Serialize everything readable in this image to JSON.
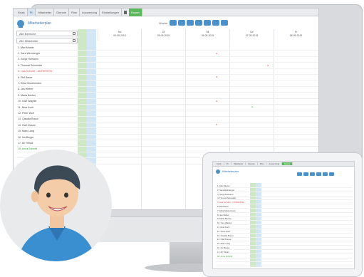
{
  "monitor": {
    "tabs": [
      "Kiosk",
      "Pl.",
      "Mitarbeiter",
      "Dienste",
      "Plan",
      "Auswertung",
      "Einstellungen",
      "",
      "Export"
    ],
    "app_title": "Mitarbeiterplan",
    "week_label": "Woche",
    "filters": [
      "Alle Bereiche",
      "Alle Mitarbeiter"
    ],
    "days": [
      {
        "name": "Mo",
        "date": "04.05.2015"
      },
      {
        "name": "Di",
        "date": "05.05.2015"
      },
      {
        "name": "Mi",
        "date": "06.05.2015"
      },
      {
        "name": "Do",
        "date": "07.05.2015"
      },
      {
        "name": "Fr",
        "date": "08.05.2015"
      }
    ],
    "rows": [
      {
        "name": "1. Max Muster",
        "style": ""
      },
      {
        "name": "2. Sara Weinberger",
        "style": ""
      },
      {
        "name": "3. Sonja Hofmann",
        "style": ""
      },
      {
        "name": "4. Thomas Schneider",
        "style": ""
      },
      {
        "name": "5. Lisa Schulze - UNTERSTEL",
        "style": "red"
      },
      {
        "name": "6. Phil Bauer",
        "style": ""
      },
      {
        "name": "7. Erika Mustermann",
        "style": ""
      },
      {
        "name": "8. Jan Weber",
        "style": ""
      },
      {
        "name": "9. Maria Becker",
        "style": ""
      },
      {
        "name": "10. Uwe Wagner",
        "style": ""
      },
      {
        "name": "11. Nina Koch",
        "style": ""
      },
      {
        "name": "12. Peter Wolf",
        "style": ""
      },
      {
        "name": "13. Claudia Braun",
        "style": ""
      },
      {
        "name": "14. Olaf Krause",
        "style": ""
      },
      {
        "name": "15. Marc Lang",
        "style": ""
      },
      {
        "name": "16. Iris Berger",
        "style": ""
      },
      {
        "name": "17. Ali Yilmaz",
        "style": ""
      },
      {
        "name": "18. Anna Schmitt",
        "style": "green"
      },
      {
        "name": "",
        "style": ""
      },
      {
        "name": "",
        "style": ""
      }
    ],
    "footer_labels": [
      "08 Std",
      "08 Std",
      "08 Std"
    ]
  },
  "tablet": {
    "tabs": [
      "Kiosk",
      "Pl.",
      "Mitarbeiter",
      "Dienste",
      "Plan",
      "Auswertung",
      "Export"
    ],
    "title": "Mitarbeiterplan"
  },
  "colors": {
    "accent": "#4a90c9",
    "green_col": "#cfe8c4",
    "blue_col": "#d3e6f7",
    "red": "#d9534f"
  }
}
